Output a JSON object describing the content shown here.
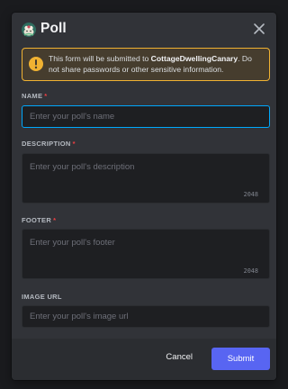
{
  "modal": {
    "title": "Poll",
    "app_icon": "bot-avatar-icon",
    "close_icon": "close-icon"
  },
  "notice": {
    "icon": "warning-icon",
    "prefix": "This form will be submitted to ",
    "username": "CottageDwellingCanary",
    "suffix": ". Do not share passwords or other sensitive information.",
    "border_color": "#f0b232"
  },
  "fields": {
    "name": {
      "label": "Name",
      "required": "*",
      "placeholder": "Enter your poll's name",
      "value": ""
    },
    "description": {
      "label": "Description",
      "required": "*",
      "placeholder": "Enter your poll's description",
      "value": "",
      "counter": "2048"
    },
    "footer": {
      "label": "Footer",
      "required": "*",
      "placeholder": "Enter your poll's footer",
      "value": "",
      "counter": "2048"
    },
    "image_url": {
      "label": "Image URL",
      "placeholder": "Enter your poll's image url",
      "value": ""
    }
  },
  "actions": {
    "cancel_label": "Cancel",
    "submit_label": "Submit",
    "submit_color": "#5865f2"
  }
}
